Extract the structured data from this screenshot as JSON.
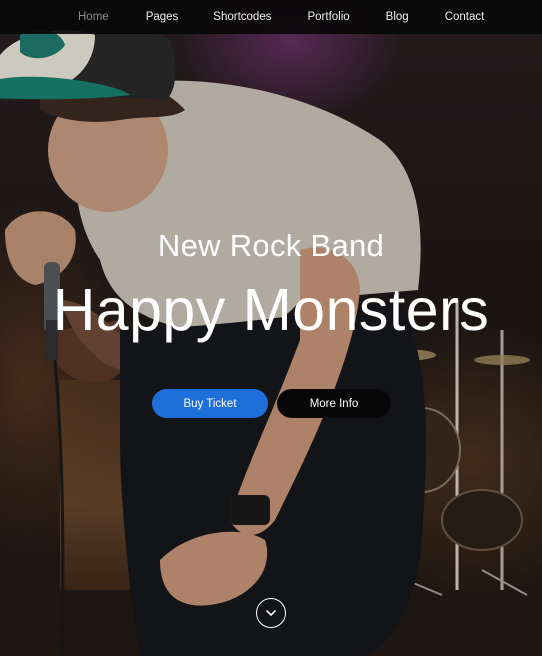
{
  "nav": {
    "items": [
      {
        "label": "Home",
        "active": true
      },
      {
        "label": "Pages",
        "active": false
      },
      {
        "label": "Shortcodes",
        "active": false
      },
      {
        "label": "Portfolio",
        "active": false
      },
      {
        "label": "Blog",
        "active": false
      },
      {
        "label": "Contact",
        "active": false
      }
    ]
  },
  "hero": {
    "subtitle": "New Rock Band",
    "title": "Happy Monsters",
    "primary_button": "Buy Ticket",
    "secondary_button": "More Info",
    "scroll_icon": "chevron-down-icon"
  },
  "colors": {
    "accent": "#1e6fd9",
    "nav_bg": "#080808",
    "nav_active": "#8c8c8c",
    "text": "#ffffff"
  }
}
